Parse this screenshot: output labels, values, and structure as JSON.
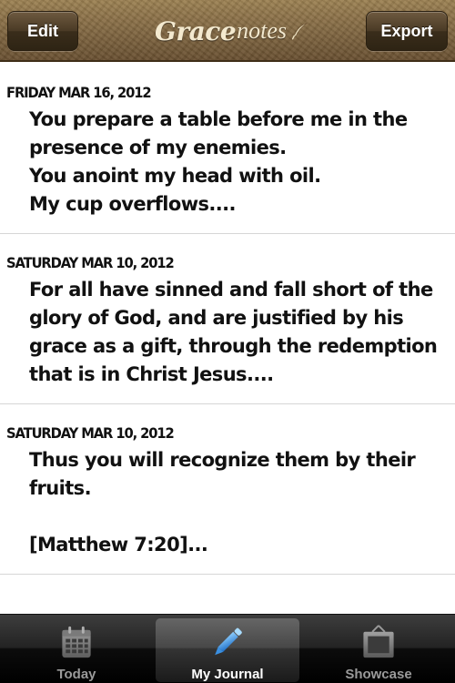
{
  "header": {
    "edit_label": "Edit",
    "export_label": "Export",
    "logo_grace": "Grace",
    "logo_notes": "notes"
  },
  "entries": [
    {
      "date": "FRIDAY MAR 16, 2012",
      "text": "You prepare a table before me in the\npresence of my enemies.\nYou anoint my head with oil.\nMy cup overflows...."
    },
    {
      "date": "SATURDAY MAR 10, 2012",
      "text": "For all have sinned and fall short of the\nglory of God, and are justified by his\ngrace as a gift, through the redemption\nthat is in Christ Jesus...."
    },
    {
      "date": "SATURDAY MAR 10, 2012",
      "text": "Thus you will recognize them by their\nfruits.\n\n[Matthew 7:20]..."
    }
  ],
  "tabbar": {
    "tabs": [
      {
        "label": "Today",
        "icon": "calendar-icon",
        "selected": false
      },
      {
        "label": "My Journal",
        "icon": "pencil-icon",
        "selected": true
      },
      {
        "label": "Showcase",
        "icon": "easel-frame-icon",
        "selected": false
      }
    ]
  },
  "colors": {
    "header_leather": "#7f6540",
    "tab_selected_text": "#ffffff",
    "tab_unselected_text": "#9a9a9a",
    "pencil_accent": "#3a8fe0"
  }
}
